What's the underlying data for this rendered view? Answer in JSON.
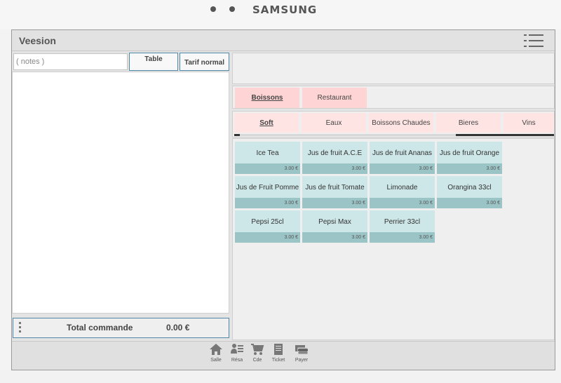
{
  "device": {
    "brand": "SAMSUNG"
  },
  "app": {
    "title": "Veesion"
  },
  "left": {
    "notes_placeholder": "( notes )",
    "table_label": "Table",
    "tarif_label": "Tarif normal",
    "total_label": "Total commande",
    "total_value": "0.00 €"
  },
  "categories": [
    {
      "label": "Boissons",
      "active": true
    },
    {
      "label": "Restaurant",
      "active": false
    }
  ],
  "subcategories": [
    {
      "label": "Soft",
      "active": true
    },
    {
      "label": "Eaux",
      "active": false
    },
    {
      "label": "Boissons Chaudes",
      "active": false
    },
    {
      "label": "Bieres",
      "active": false
    },
    {
      "label": "Vins",
      "active": false
    }
  ],
  "products": [
    {
      "name": "Ice Tea",
      "price": "3.00 €"
    },
    {
      "name": "Jus de fruit A.C.E",
      "price": "3.00 €"
    },
    {
      "name": "Jus de fruit Ananas",
      "price": "3.00 €"
    },
    {
      "name": "Jus de fruit Orange",
      "price": "3.00 €"
    },
    {
      "name": "Jus de Fruit Pomme",
      "price": "3.00 €"
    },
    {
      "name": "Jus de fruit Tomate",
      "price": "3.00 €"
    },
    {
      "name": "Limonade",
      "price": "3.00 €"
    },
    {
      "name": "Orangina 33cl",
      "price": "3.00 €"
    },
    {
      "name": "Pepsi 25cl",
      "price": "3.00 €"
    },
    {
      "name": "Pepsi Max",
      "price": "3.00 €"
    },
    {
      "name": "Perrier 33cl",
      "price": "3.00 €"
    }
  ],
  "nav": [
    {
      "label": "Salle",
      "icon": "home-icon"
    },
    {
      "label": "Résa",
      "icon": "reservation-icon"
    },
    {
      "label": "Cde",
      "icon": "cart-icon"
    },
    {
      "label": "Ticket",
      "icon": "ticket-icon"
    },
    {
      "label": "Payer",
      "icon": "payment-card-icon"
    }
  ],
  "colors": {
    "category_bg": "#ffd4d4",
    "subcategory_bg": "#ffe4e4",
    "product_bg": "#cde6e7",
    "price_bg": "#9bc4c6",
    "accent_border": "#4f88a8"
  }
}
